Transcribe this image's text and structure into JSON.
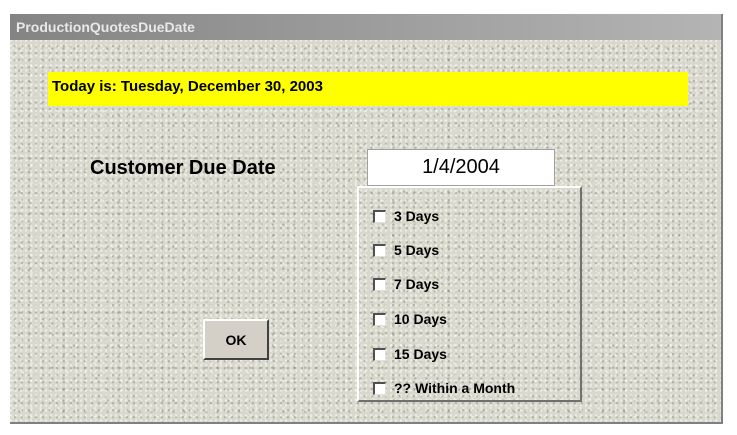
{
  "window": {
    "title": "ProductionQuotesDueDate"
  },
  "today_banner": {
    "text": "Today is:  Tuesday, December 30, 2003",
    "color": "#ffff00"
  },
  "customer_due_date": {
    "label": "Customer Due Date",
    "value": "1/4/2004"
  },
  "options": [
    {
      "label": "3 Days",
      "checked": false
    },
    {
      "label": "5 Days",
      "checked": false
    },
    {
      "label": "7 Days",
      "checked": false
    },
    {
      "label": "10 Days",
      "checked": false
    },
    {
      "label": "15 Days",
      "checked": false
    },
    {
      "label": "?? Within a Month",
      "checked": false
    }
  ],
  "ok_button": {
    "label": "OK"
  }
}
